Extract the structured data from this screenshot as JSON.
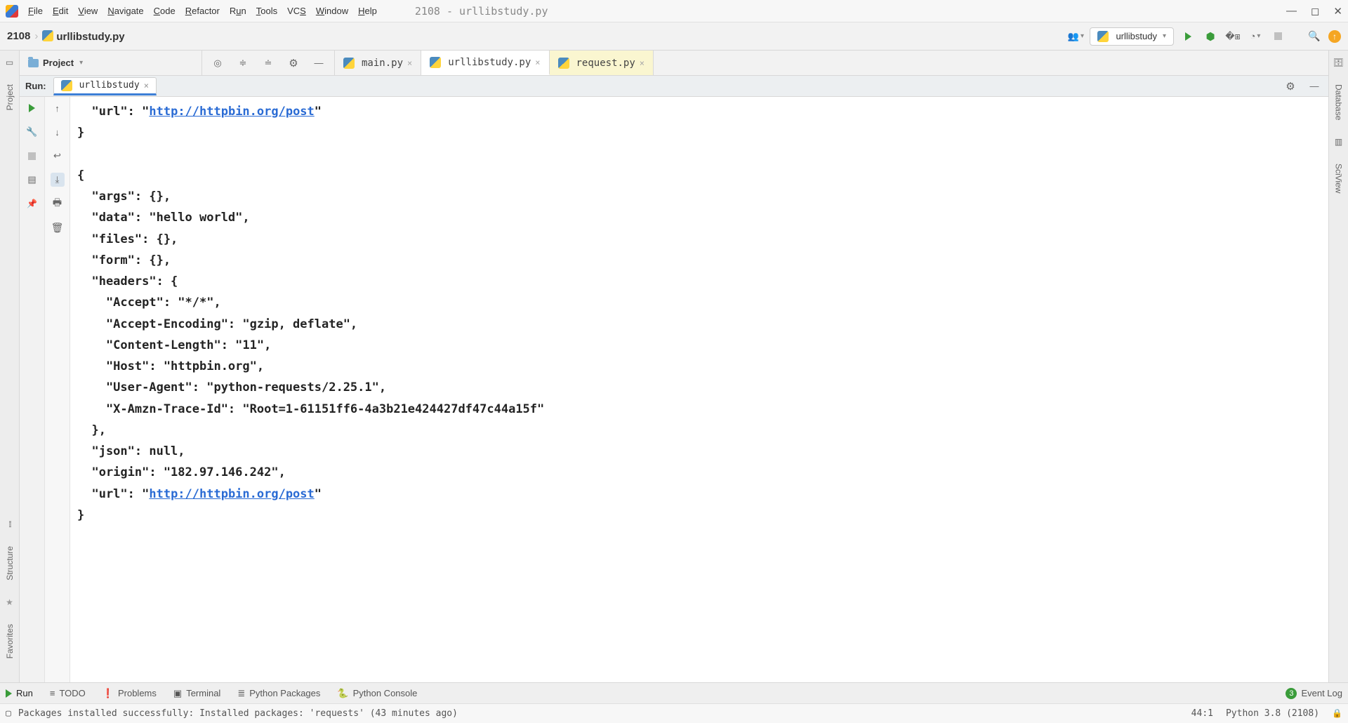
{
  "menu": {
    "items": [
      "File",
      "Edit",
      "View",
      "Navigate",
      "Code",
      "Refactor",
      "Run",
      "Tools",
      "VCS",
      "Window",
      "Help"
    ],
    "underlines": [
      "F",
      "E",
      "V",
      "N",
      "C",
      "R",
      "R",
      "T",
      "S",
      "W",
      "H"
    ],
    "title": "2108 - urllibstudy.py"
  },
  "breadcrumb": {
    "project": "2108",
    "file": "urllibstudy.py"
  },
  "run_config": {
    "name": "urllibstudy"
  },
  "project_panel": {
    "title": "Project"
  },
  "tabs": [
    {
      "name": "main.py",
      "active": false,
      "highlight": false
    },
    {
      "name": "urllibstudy.py",
      "active": true,
      "highlight": false
    },
    {
      "name": "request.py",
      "active": false,
      "highlight": true
    }
  ],
  "run_panel": {
    "label": "Run:",
    "tab": "urllibstudy"
  },
  "console": {
    "url_label": "\"url\": \"",
    "url_link": "http://httpbin.org/post",
    "url_tail": "\"",
    "block1_close": "}",
    "block2": [
      "{",
      "  \"args\": {},",
      "  \"data\": \"hello world\",",
      "  \"files\": {},",
      "  \"form\": {},",
      "  \"headers\": {",
      "    \"Accept\": \"*/*\",",
      "    \"Accept-Encoding\": \"gzip, deflate\",",
      "    \"Content-Length\": \"11\",",
      "    \"Host\": \"httpbin.org\",",
      "    \"User-Agent\": \"python-requests/2.25.1\",",
      "    \"X-Amzn-Trace-Id\": \"Root=1-61151ff6-4a3b21e424427df47c44a15f\"",
      "  },",
      "  \"json\": null,",
      "  \"origin\": \"182.97.146.242\","
    ],
    "url2_prefix": "  \"url\": \"",
    "url2_link": "http://httpbin.org/post",
    "url2_tail": "\"",
    "block2_close": "}"
  },
  "left_tools": {
    "project": "Project",
    "structure": "Structure",
    "favorites": "Favorites"
  },
  "right_tools": {
    "database": "Database",
    "sciview": "SciView"
  },
  "bottom_tabs": {
    "run": "Run",
    "todo": "TODO",
    "problems": "Problems",
    "terminal": "Terminal",
    "packages": "Python Packages",
    "console": "Python Console",
    "event_log": "Event Log",
    "badge": "3"
  },
  "status": {
    "msg": "Packages installed successfully: Installed packages: 'requests' (43 minutes ago)",
    "pos": "44:1",
    "interp": "Python 3.8 (2108)"
  }
}
